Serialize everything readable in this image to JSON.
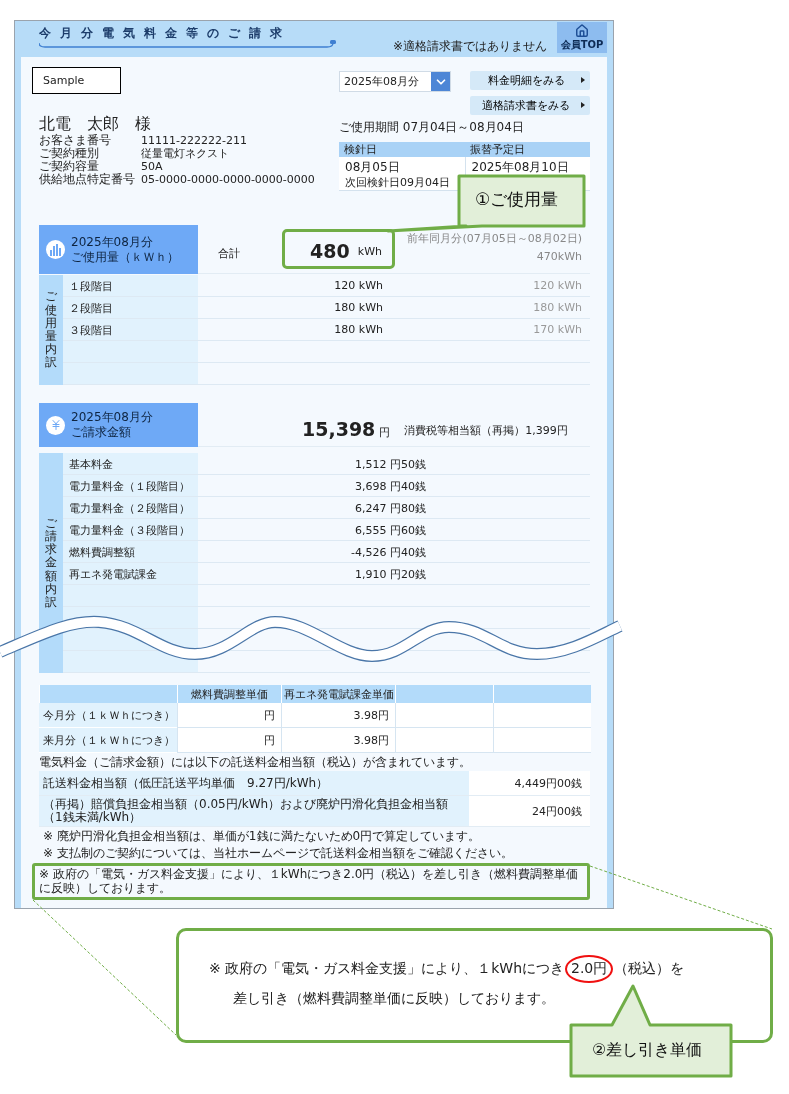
{
  "header": {
    "title": "今月分電気料金等のご請求",
    "notice": "※適格請求書ではありません",
    "top_button": "会員TOP"
  },
  "sample_label": "Sample",
  "customer": {
    "name": "北電　太郎　様",
    "fields": [
      {
        "label": "お客さま番号",
        "value": "11111-222222-211"
      },
      {
        "label": "ご契約種別",
        "value": "従量電灯ネクスト"
      },
      {
        "label": "ご契約容量",
        "value": "50A"
      },
      {
        "label": "供給地点特定番号",
        "value": "05-0000-0000-0000-0000-0000"
      }
    ]
  },
  "month_select": {
    "value": "2025年08月分"
  },
  "links": [
    "料金明細をみる",
    "適格請求書をみる"
  ],
  "usage_period": "ご使用期間 07月04日～08月04日",
  "meter": {
    "columns": [
      "検針日",
      "振替予定日"
    ],
    "reading_date": "08月05日",
    "next_reading": "次回検針日09月04日",
    "transfer_date": "2025年08月10日"
  },
  "usage": {
    "month": "2025年08月分",
    "title": "ご使用量（ｋＷｈ）",
    "total_label": "合計",
    "total": "480",
    "unit": "kWh",
    "highlighted": true,
    "prev_label": "前年同月分(07月05日～08月02日)",
    "prev_total": "470",
    "prev_unit": "kWh",
    "side_label": "ご使用量内訳",
    "rows": [
      {
        "label": "１段階目",
        "value": "120 kWh",
        "prev": "120 kWh"
      },
      {
        "label": "２段階目",
        "value": "180 kWh",
        "prev": "180 kWh"
      },
      {
        "label": "３段階目",
        "value": "180 kWh",
        "prev": "170 kWh"
      }
    ]
  },
  "bill": {
    "month": "2025年08月分",
    "title": "ご請求金額",
    "total": "15,398",
    "unit": "円",
    "tax_note": "消費税等相当額（再掲）1,399円",
    "side_label": "ご請求金額内訳",
    "rows": [
      {
        "label": "基本料金",
        "value": "1,512 円50銭"
      },
      {
        "label": "電力量料金（１段階目）",
        "value": "3,698 円40銭"
      },
      {
        "label": "電力量料金（２段階目）",
        "value": "6,247 円80銭"
      },
      {
        "label": "電力量料金（３段階目）",
        "value": "6,555 円60銭"
      },
      {
        "label": "燃料費調整額",
        "value": "-4,526 円40銭"
      },
      {
        "label": "再エネ発電賦課金",
        "value": "1,910 円20銭"
      }
    ]
  },
  "unit_prices": {
    "columns": [
      "燃料費調整単価",
      "再エネ発電賦課金単価"
    ],
    "rows": [
      {
        "label": "今月分（１ｋＷｈにつき）",
        "cells": [
          "円",
          "3.98円"
        ]
      },
      {
        "label": "来月分（１ｋＷｈにつき）",
        "cells": [
          "円",
          "3.98円"
        ]
      }
    ]
  },
  "transfer_note": "電気料金（ご請求金額）には以下の託送料金相当額（税込）が含まれています。",
  "transfer": [
    {
      "label": "託送料金相当額（低圧託送平均単価　9.27円/kWh）",
      "value": "4,449円00銭"
    },
    {
      "label": "（再掲）賠償負担金相当額（0.05円/kWh）および廃炉円滑化負担金相当額（1銭未満/kWh）",
      "value": "24円00銭"
    }
  ],
  "footnotes": [
    {
      "text": "※ 廃炉円滑化負担金相当額は、単価が1銭に満たないため0円で算定しています。",
      "highlighted": false
    },
    {
      "text": "※ 支払制のご契約については、当社ホームページで託送料金相当額をご確認ください。",
      "highlighted": false
    },
    {
      "text": "※ 政府の「電気・ガス料金支援」により、１kWhにつき2.0円（税込）を差し引き（燃料費調整単価に反映）しております。",
      "highlighted": true
    }
  ],
  "annotations": {
    "usage_callout": "①ご使用量",
    "note": {
      "before": "※ 政府の「電気・ガス料金支援」により、１kWhにつき",
      "circled": "2.0円",
      "after": "（税込）を",
      "line2": "差し引き（燃料費調整単価に反映）しております。"
    },
    "unit_callout": "②差し引き単価"
  }
}
